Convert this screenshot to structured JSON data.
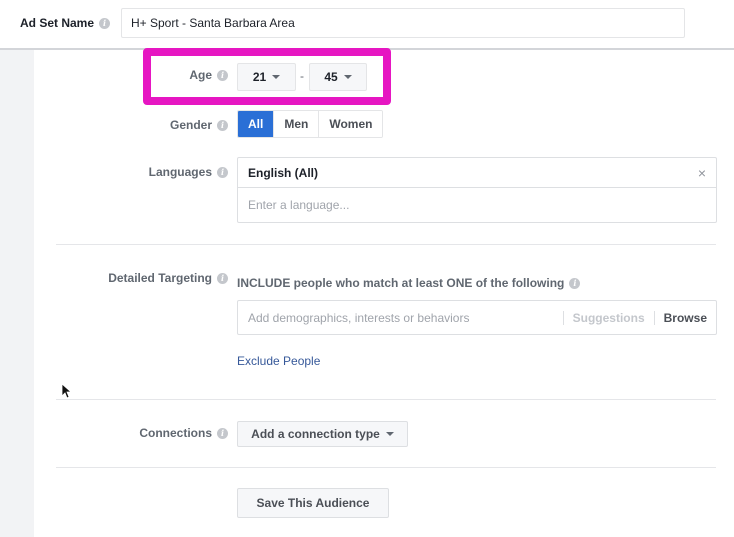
{
  "ad_set": {
    "label": "Ad Set Name",
    "name_value": "H+ Sport - Santa Barbara Area"
  },
  "age": {
    "label": "Age",
    "min": "21",
    "max": "45",
    "separator": "-",
    "highlight_color": "#e616c2"
  },
  "gender": {
    "label": "Gender",
    "options": [
      "All",
      "Men",
      "Women"
    ],
    "selected": "All",
    "active_color": "#2a6fd6"
  },
  "languages": {
    "label": "Languages",
    "selected": [
      "English (All)"
    ],
    "remove_glyph": "×",
    "placeholder": "Enter a language..."
  },
  "detailed_targeting": {
    "label": "Detailed Targeting",
    "include_text": "INCLUDE people who match at least ONE of the following",
    "placeholder": "Add demographics, interests or behaviors",
    "suggestions_label": "Suggestions",
    "browse_label": "Browse",
    "exclude_link": "Exclude People"
  },
  "connections": {
    "label": "Connections",
    "button_label": "Add a connection type"
  },
  "save_audience_label": "Save This Audience",
  "info_glyph": "i"
}
